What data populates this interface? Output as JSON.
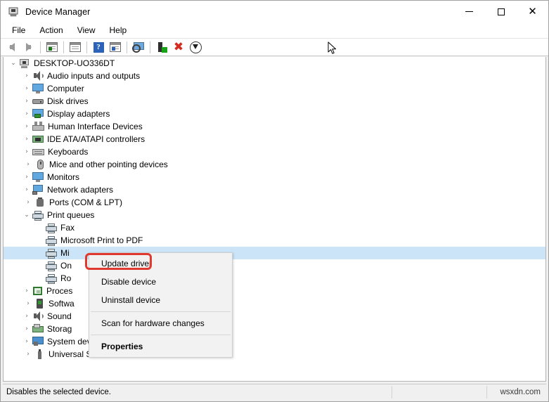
{
  "window": {
    "title": "Device Manager",
    "icon": "device-manager-icon",
    "controls": {
      "minimize": "minimize-button",
      "maximize": "maximize-button",
      "close": "close-button"
    }
  },
  "menubar": {
    "items": [
      {
        "label": "File",
        "name": "menu-file"
      },
      {
        "label": "Action",
        "name": "menu-action"
      },
      {
        "label": "View",
        "name": "menu-view"
      },
      {
        "label": "Help",
        "name": "menu-help"
      }
    ]
  },
  "toolbar": {
    "buttons": [
      {
        "name": "back-icon",
        "kind": "arrow-left"
      },
      {
        "name": "forward-icon",
        "kind": "arrow-right"
      },
      {
        "name": "show-hide-console-tree-icon",
        "kind": "win-green"
      },
      {
        "name": "properties-icon",
        "kind": "win-plain"
      },
      {
        "name": "help-icon",
        "kind": "help"
      },
      {
        "name": "show-hide-action-pane-icon",
        "kind": "win-blue"
      },
      {
        "name": "scan-for-hardware-changes-icon",
        "kind": "monitor"
      },
      {
        "name": "update-driver-icon",
        "kind": "driver"
      },
      {
        "name": "uninstall-device-icon",
        "kind": "x"
      },
      {
        "name": "disable-device-icon",
        "kind": "down"
      }
    ]
  },
  "tree": {
    "root": {
      "label": "DESKTOP-UO336DT",
      "icon": "computer-root-icon",
      "expanded": true
    },
    "nodes": [
      {
        "label": "Audio inputs and outputs",
        "icon": "speaker-icon",
        "state": "collapsed",
        "level": 1
      },
      {
        "label": "Computer",
        "icon": "monitor-icon",
        "state": "collapsed",
        "level": 1
      },
      {
        "label": "Disk drives",
        "icon": "disk-icon",
        "state": "collapsed",
        "level": 1
      },
      {
        "label": "Display adapters",
        "icon": "display-adapter-icon",
        "state": "collapsed",
        "level": 1
      },
      {
        "label": "Human Interface Devices",
        "icon": "hid-icon",
        "state": "collapsed",
        "level": 1
      },
      {
        "label": "IDE ATA/ATAPI controllers",
        "icon": "ide-controller-icon",
        "state": "collapsed",
        "level": 1
      },
      {
        "label": "Keyboards",
        "icon": "keyboard-icon",
        "state": "collapsed",
        "level": 1
      },
      {
        "label": "Mice and other pointing devices",
        "icon": "mouse-icon",
        "state": "collapsed",
        "level": 1
      },
      {
        "label": "Monitors",
        "icon": "monitor-icon",
        "state": "collapsed",
        "level": 1
      },
      {
        "label": "Network adapters",
        "icon": "network-adapter-icon",
        "state": "collapsed",
        "level": 1
      },
      {
        "label": "Ports (COM & LPT)",
        "icon": "port-icon",
        "state": "collapsed",
        "level": 1
      },
      {
        "label": "Print queues",
        "icon": "printer-icon",
        "state": "expanded",
        "level": 1
      },
      {
        "label": "Fax",
        "icon": "printer-icon",
        "state": "leaf",
        "level": 2
      },
      {
        "label": "Microsoft Print to PDF",
        "icon": "printer-icon",
        "state": "leaf",
        "level": 2
      },
      {
        "label": "Mi",
        "icon": "printer-icon",
        "state": "leaf",
        "level": 2,
        "selected": true
      },
      {
        "label": "On",
        "icon": "printer-icon",
        "state": "leaf",
        "level": 2
      },
      {
        "label": "Ro",
        "icon": "printer-icon",
        "state": "leaf",
        "level": 2
      },
      {
        "label": "Proces",
        "icon": "processor-icon",
        "state": "collapsed",
        "level": 1
      },
      {
        "label": "Softwa",
        "icon": "software-device-icon",
        "state": "collapsed",
        "level": 1
      },
      {
        "label": "Sound",
        "icon": "speaker-icon",
        "state": "collapsed",
        "level": 1
      },
      {
        "label": "Storag",
        "icon": "storage-controller-icon",
        "state": "collapsed",
        "level": 1
      },
      {
        "label": "System devices",
        "icon": "system-device-icon",
        "state": "collapsed",
        "level": 1
      },
      {
        "label": "Universal Serial Bus controllers",
        "icon": "usb-controller-icon",
        "state": "collapsed",
        "level": 1
      }
    ],
    "chevron_collapsed": "›",
    "chevron_expanded": "⌄"
  },
  "context_menu": {
    "items": [
      {
        "label": "Update driver",
        "name": "ctx-update-driver",
        "bold": false,
        "separator_before": false
      },
      {
        "label": "Disable device",
        "name": "ctx-disable-device",
        "bold": false,
        "separator_before": false
      },
      {
        "label": "Uninstall device",
        "name": "ctx-uninstall-device",
        "bold": false,
        "separator_before": false
      },
      {
        "label": "Scan for hardware changes",
        "name": "ctx-scan-hardware-changes",
        "bold": false,
        "separator_before": true
      },
      {
        "label": "Properties",
        "name": "ctx-properties",
        "bold": true,
        "separator_before": true
      }
    ]
  },
  "highlight": {
    "target": "Update driver",
    "color": "#e03a30"
  },
  "statusbar": {
    "message": "Disables the selected device.",
    "middle": "",
    "watermark": "wsxdn.com"
  },
  "colors": {
    "selection": "#cce4f7",
    "accent_red": "#e03a30",
    "window_bg": "#f0f0f0",
    "panel_bg": "#ffffff"
  }
}
